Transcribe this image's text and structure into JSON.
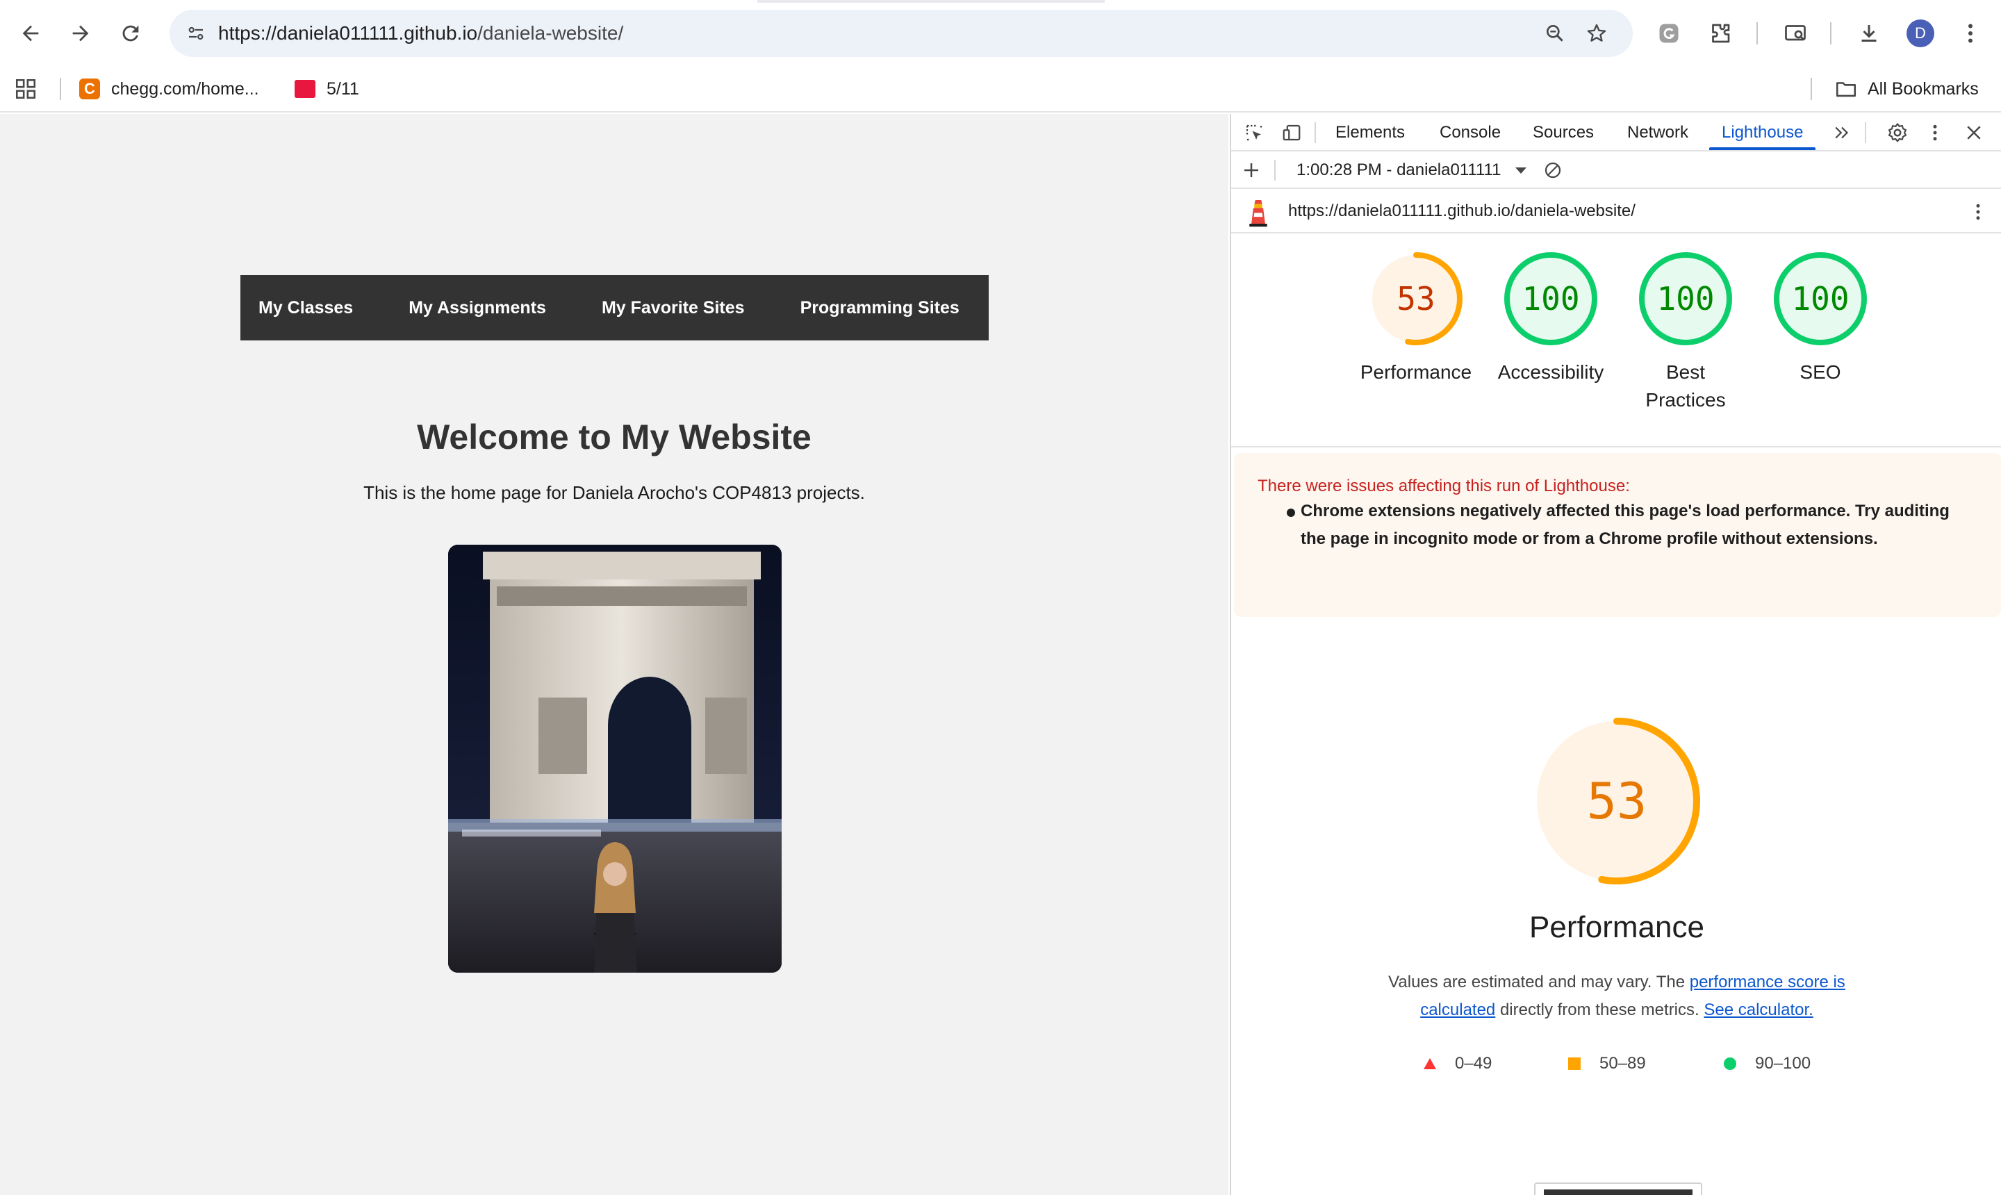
{
  "browser": {
    "url_host": "https://daniela011111.github.io",
    "url_path": "/daniela-website/",
    "profile_initial": "D",
    "icons": [
      "back-arrow-icon",
      "forward-arrow-icon",
      "reload-icon",
      "site-info-icon",
      "zoom-icon",
      "star-icon",
      "grammarly-icon",
      "extensions-icon",
      "screen-search-icon",
      "download-icon",
      "more-vertical-icon"
    ]
  },
  "bookmarks": {
    "items": [
      {
        "label": "chegg.com/home...",
        "icon": "chegg-favicon",
        "color": "#eb7100"
      },
      {
        "label": "5/11",
        "icon": "red-favicon",
        "color": "#e8173f"
      }
    ],
    "all_label": "All Bookmarks"
  },
  "website": {
    "nav": [
      "My Classes",
      "My Assignments",
      "My Favorite Sites",
      "Programming Sites"
    ],
    "heading": "Welcome to My Website",
    "subtitle": "This is the home page for Daniela Arocho's COP4813 projects."
  },
  "devtools": {
    "tabs": [
      "Elements",
      "Console",
      "Sources",
      "Network",
      "Lighthouse"
    ],
    "active_tab": "Lighthouse",
    "report_selector": "1:00:28 PM - daniela011111",
    "report_url": "https://daniela011111.github.io/daniela-website/",
    "gauges": [
      {
        "score": "53",
        "label": "Performance",
        "value": 53,
        "color": "#ffa400",
        "text_color": "#c33300",
        "bg": "#fff3e6"
      },
      {
        "score": "100",
        "label": "Accessibility",
        "value": 100,
        "color": "#0cce6b",
        "text_color": "#008800",
        "bg": "#e6faef"
      },
      {
        "score": "100",
        "label": "Best Practices",
        "value": 100,
        "color": "#0cce6b",
        "text_color": "#008800",
        "bg": "#e6faef"
      },
      {
        "score": "100",
        "label": "SEO",
        "value": 100,
        "color": "#0cce6b",
        "text_color": "#008800",
        "bg": "#e6faef"
      }
    ],
    "warning": {
      "title": "There were issues affecting this run of Lighthouse:",
      "item": "Chrome extensions negatively affected this page's load performance. Try auditing the page in incognito mode or from a Chrome profile without extensions."
    },
    "performance": {
      "score": "53",
      "value": 53,
      "title": "Performance",
      "desc_prefix": "Values are estimated and may vary. The ",
      "desc_link1": "performance score is calculated",
      "desc_middle": " directly from these metrics. ",
      "desc_link2": "See calculator.",
      "legend": [
        {
          "range": "0–49",
          "shape": "triangle",
          "color": "#ff3333"
        },
        {
          "range": "50–89",
          "shape": "square",
          "color": "#ffa400"
        },
        {
          "range": "90–100",
          "shape": "circle",
          "color": "#0cce6b"
        }
      ]
    }
  }
}
